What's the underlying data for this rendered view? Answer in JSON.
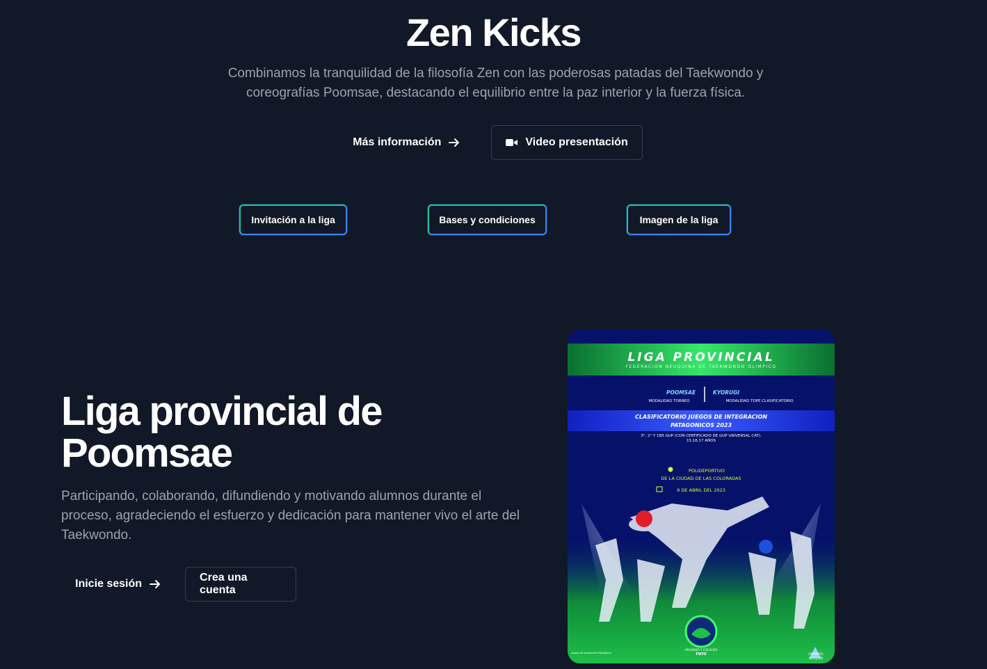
{
  "hero": {
    "title": "Zen Kicks",
    "subtitle": "Combinamos la tranquilidad de la filosofía Zen con las poderosas patadas del Taekwondo y coreografías Poomsae, destacando el equilibrio entre la paz interior y la fuerza física.",
    "more_info_label": "Más información",
    "video_label": "Video presentación"
  },
  "league_buttons": [
    {
      "label": "Invitación a la liga"
    },
    {
      "label": "Bases y condiciones"
    },
    {
      "label": "Imagen de la liga"
    }
  ],
  "section": {
    "title": "Liga provincial de Poomsae",
    "subtitle": "Participando, colaborando, difundiendo y motivando alumnos durante el proceso, agradeciendo el esfuerzo y dedicación para mantener vivo el arte del Taekwondo.",
    "login_label": "Inicie sesión",
    "signup_label": "Crea una cuenta"
  },
  "poster": {
    "title": "LIGA PROVINCIAL",
    "federation": "FEDERACION NEUQUINA DE TAEKWONDO OLIMPICO",
    "poomsae": "POOMSAE",
    "kyorugi": "KYORUGI",
    "mod_torneo": "MODALIDAD TORNEO",
    "mod_tope": "MODALIDAD TOPE CLASIFICATORIO",
    "clasif_line1": "CLASIFICATORIO JUEGOS DE INTEGRACION",
    "clasif_line2": "PATAGONICOS 2023",
    "gup_line1": "3°, 2° Y 1ER GUP (CON CERTIFICADO DE GUP UNIVERSAL CAT).",
    "gup_line2": "15,16,17 AÑOS",
    "venue_line1": "POLIDEPORTIVO",
    "venue_line2": "DE LA CIUDAD DE LAS COLORADAS",
    "date": "9 DE ABRIL DEL 2023",
    "organiza": "ORGANIZA Y FISCALIZA",
    "fnto": "FNTO",
    "left_logo": "Juegos de Integración Patagónica",
    "right_logo_line1": "DEPORTES",
    "right_logo_line2": "NEUQUÉN"
  },
  "colors": {
    "background": "#111827",
    "muted_text": "#9ca3af",
    "league_border": "#22c1a6",
    "league_border_accent": "#3b82f6"
  }
}
